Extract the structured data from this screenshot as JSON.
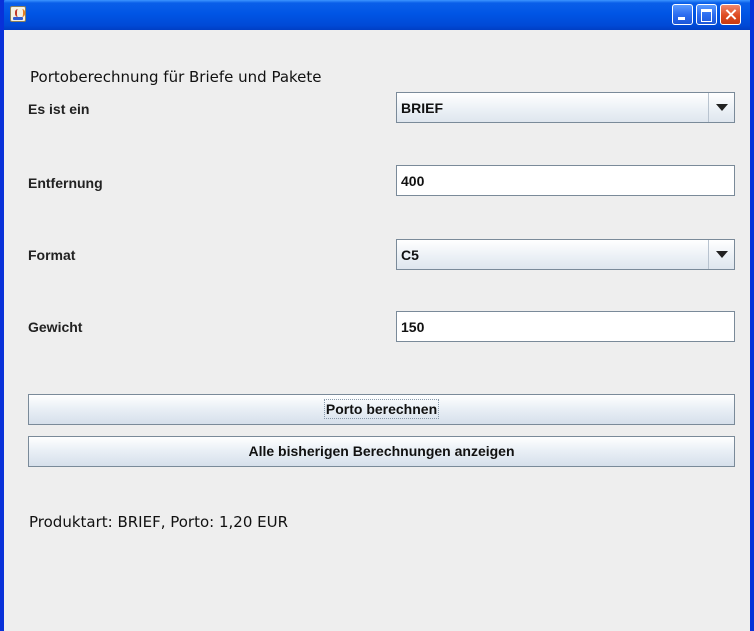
{
  "window": {
    "title": ""
  },
  "form": {
    "heading": "Portoberechnung für Briefe und Pakete",
    "type_label": "Es ist ein",
    "type_value": "BRIEF",
    "distance_label": "Entfernung",
    "distance_value": "400",
    "format_label": "Format",
    "format_value": "C5",
    "weight_label": "Gewicht",
    "weight_value": "150"
  },
  "buttons": {
    "calculate": "Porto berechnen",
    "show_all": "Alle bisherigen Berechnungen anzeigen"
  },
  "result": {
    "text": "Produktart: BRIEF, Porto: 1,20 EUR"
  },
  "icons": {
    "app": "java-cup-icon",
    "minimize": "minimize-icon",
    "maximize": "maximize-icon",
    "close": "close-icon",
    "dropdown": "chevron-down-icon"
  },
  "colors": {
    "titlebar": "#0055e5",
    "frame": "#0831d9",
    "content_background": "#eeeeee",
    "close_button": "#de4b21"
  }
}
